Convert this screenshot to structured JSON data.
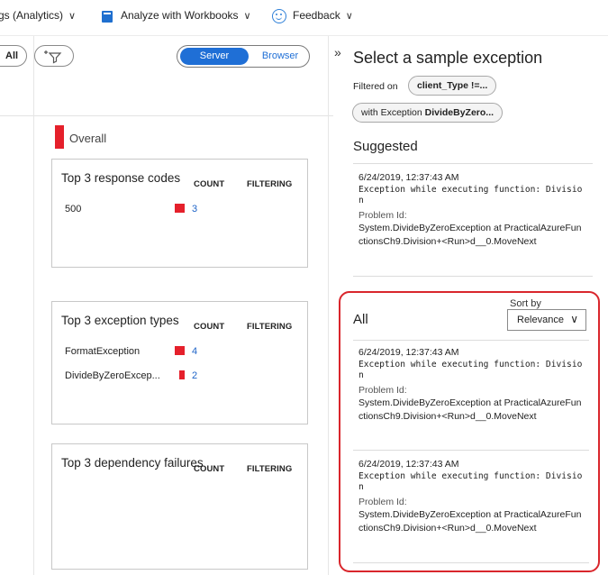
{
  "toolbar": {
    "logs_label": "gs (Analytics)",
    "workbooks_label": "Analyze with Workbooks",
    "feedback_label": "Feedback",
    "chevron": "∨"
  },
  "filters": {
    "all_label": "All",
    "add_filter_icon": "add-filter-icon",
    "server_label": "Server",
    "browser_label": "Browser"
  },
  "overall_label": "Overall",
  "cards": {
    "response_codes": {
      "title": "Top 3 response codes",
      "count_header": "COUNT",
      "filtering_header": "FILTERING",
      "rows": [
        {
          "name": "500",
          "count": "3"
        }
      ]
    },
    "exception_types": {
      "title": "Top 3 exception types",
      "count_header": "COUNT",
      "filtering_header": "FILTERING",
      "rows": [
        {
          "name": "FormatException",
          "count": "4"
        },
        {
          "name": "DivideByZeroExcep...",
          "count": "2"
        }
      ]
    },
    "dependency_failures": {
      "title": "Top 3 dependency failures",
      "count_header": "COUNT",
      "filtering_header": "FILTERING"
    }
  },
  "panel": {
    "expand_glyph": "»",
    "title": "Select a sample exception",
    "filtered_on_label": "Filtered on",
    "filter_chip_1": "client_Type !=...",
    "filter_chip_2_prefix": "with Exception ",
    "filter_chip_2_bold": "DivideByZero...",
    "suggested_title": "Suggested",
    "suggested_item": {
      "timestamp": "6/24/2019, 12:37:43 AM",
      "message": "Exception while executing function: Division",
      "problem_label": "Problem Id:",
      "problem_id": "System.DivideByZeroException at PracticalAzureFunctionsCh9.Division+<Run>d__0.MoveNext"
    },
    "all_title": "All",
    "sort_by_label": "Sort by",
    "sort_value": "Relevance",
    "sort_chevron": "∨",
    "all_items": [
      {
        "timestamp": "6/24/2019, 12:37:43 AM",
        "message": "Exception while executing function: Division",
        "problem_label": "Problem Id:",
        "problem_id": "System.DivideByZeroException at PracticalAzureFunctionsCh9.Division+<Run>d__0.MoveNext"
      },
      {
        "timestamp": "6/24/2019, 12:37:43 AM",
        "message": "Exception while executing function: Division",
        "problem_label": "Problem Id:",
        "problem_id": "System.DivideByZeroException at PracticalAzureFunctionsCh9.Division+<Run>d__0.MoveNext"
      }
    ]
  },
  "colors": {
    "accent_blue": "#1f6fd6",
    "bar_red": "#e5202b",
    "highlight_frame": "#d9262c"
  }
}
